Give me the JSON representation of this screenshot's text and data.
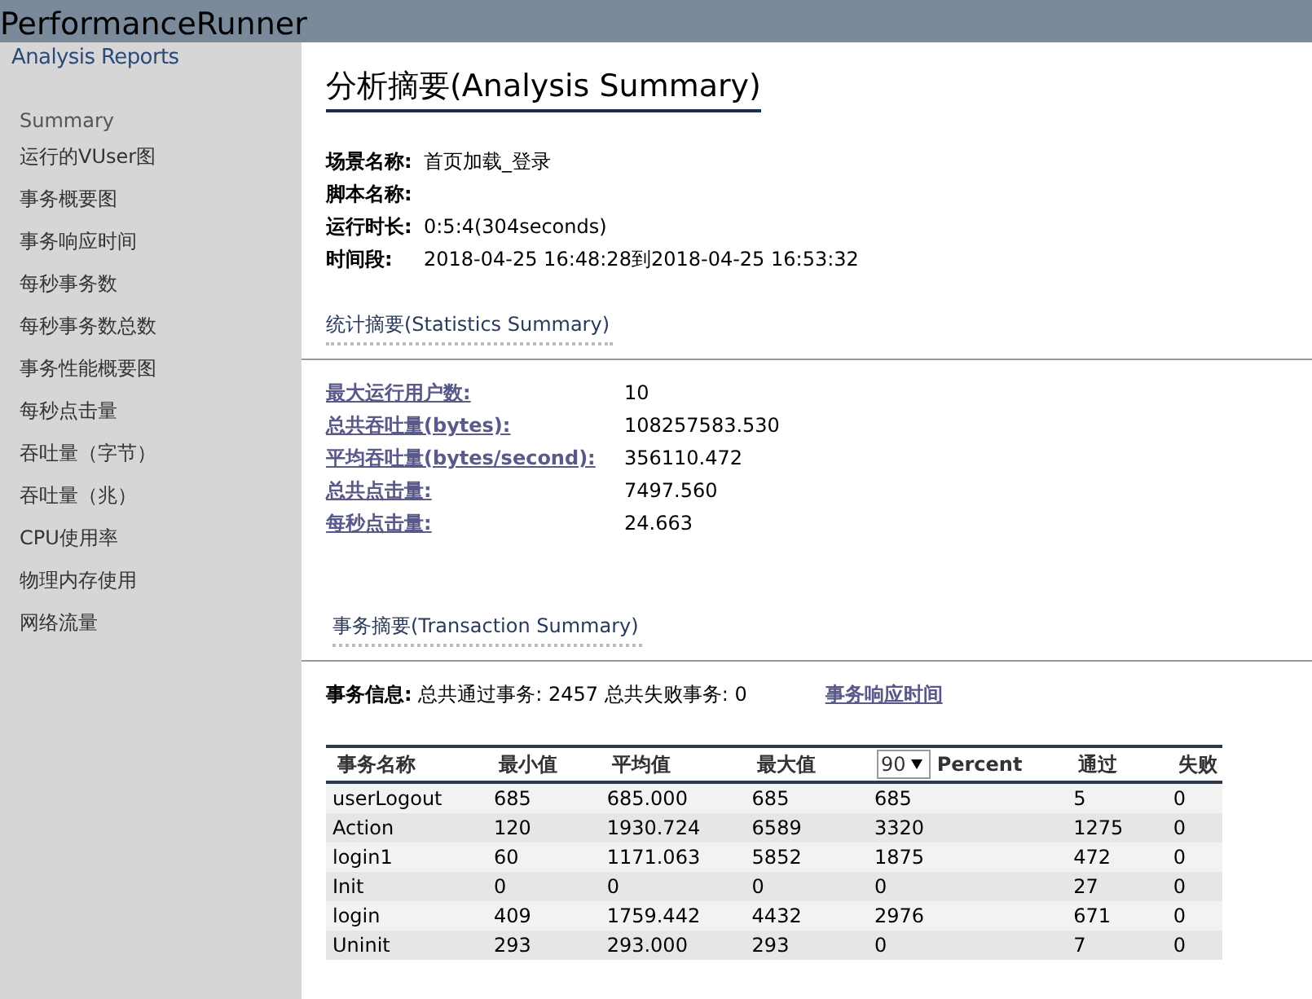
{
  "header": {
    "title": "PerformanceRunner",
    "subtitle": "Analysis Reports"
  },
  "sidebar": {
    "items": [
      {
        "label": "Summary",
        "selected": true
      },
      {
        "label": "运行的VUser图",
        "selected": false
      },
      {
        "label": "事务概要图",
        "selected": false
      },
      {
        "label": "事务响应时间",
        "selected": false
      },
      {
        "label": "每秒事务数",
        "selected": false
      },
      {
        "label": "每秒事务数总数",
        "selected": false
      },
      {
        "label": "事务性能概要图",
        "selected": false
      },
      {
        "label": "每秒点击量",
        "selected": false
      },
      {
        "label": "吞吐量（字节）",
        "selected": false
      },
      {
        "label": "吞吐量（兆）",
        "selected": false
      },
      {
        "label": "CPU使用率",
        "selected": false
      },
      {
        "label": "物理内存使用",
        "selected": false
      },
      {
        "label": "网络流量",
        "selected": false
      }
    ]
  },
  "title": "分析摘要(Analysis Summary)",
  "info": [
    {
      "label": "场景名称:",
      "value": "首页加载_登录"
    },
    {
      "label": "脚本名称:"
    },
    {
      "label": "运行时长:",
      "value": "0:5:4(304seconds)"
    },
    {
      "label": "时间段:",
      "value": "2018-04-25 16:48:28到2018-04-25 16:53:32"
    }
  ],
  "statistics": {
    "heading": "统计摘要(Statistics Summary)",
    "rows": [
      {
        "label": "最大运行用户数:",
        "value": "10"
      },
      {
        "label": "总共吞吐量(bytes):",
        "value": "108257583.530"
      },
      {
        "label": "平均吞吐量(bytes/second):",
        "value": "356110.472"
      },
      {
        "label": "总共点击量:",
        "value": "7497.560"
      },
      {
        "label": "每秒点击量:",
        "value": "24.663"
      }
    ]
  },
  "transactions": {
    "heading": "事务摘要(Transaction Summary)",
    "info_label": "事务信息:",
    "info_text": "总共通过事务: 2457 总共失败事务: 0",
    "link": "事务响应时间",
    "table": {
      "columns": [
        "事务名称",
        "最小值",
        "平均值",
        "最大值",
        {
          "select": "90",
          "label": "Percent"
        },
        "通过",
        "失败"
      ],
      "rows": [
        [
          "userLogout",
          "685",
          "685.000",
          "685",
          "685",
          "5",
          "0"
        ],
        [
          "Action",
          "120",
          "1930.724",
          "6589",
          "3320",
          "1275",
          "0"
        ],
        [
          "login1",
          "60",
          "1171.063",
          "5852",
          "1875",
          "472",
          "0"
        ],
        [
          "Init",
          "0",
          "0",
          "0",
          "0",
          "27",
          "0"
        ],
        [
          "login",
          "409",
          "1759.442",
          "4432",
          "2976",
          "671",
          "0"
        ],
        [
          "Uninit",
          "293",
          "293.000",
          "293",
          "0",
          "7",
          "0"
        ]
      ]
    }
  }
}
